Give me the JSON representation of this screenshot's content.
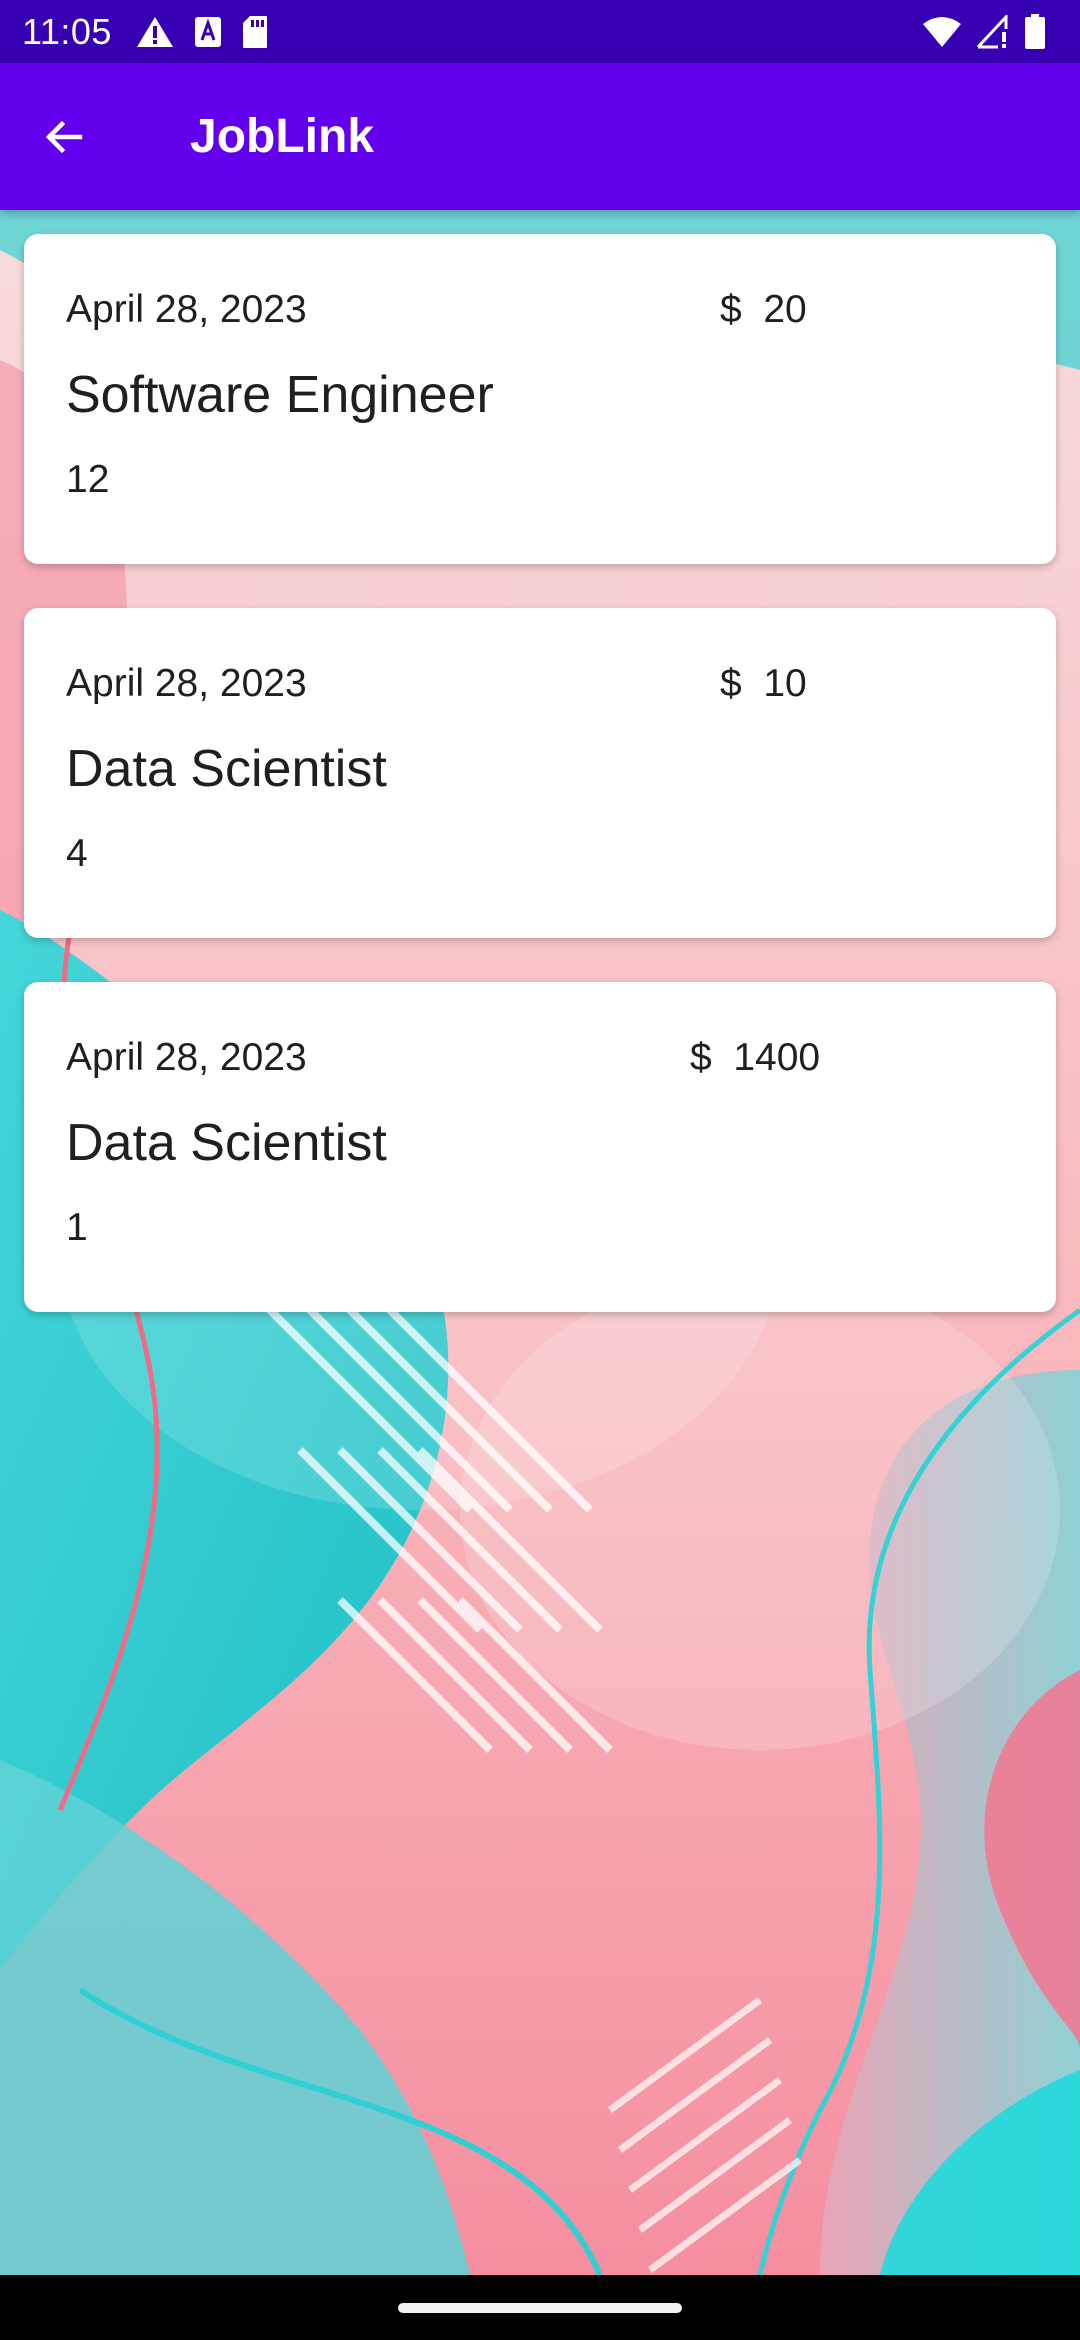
{
  "status_bar": {
    "time": "11:05",
    "icons": [
      "alert-icon",
      "text-a-icon",
      "sd-card-icon",
      "wifi-icon",
      "signal-icon",
      "battery-icon"
    ]
  },
  "app_bar": {
    "title": "JobLink",
    "back_icon": "arrow-back-icon"
  },
  "jobs": [
    {
      "date": "April 28, 2023",
      "pay": "$  20",
      "title": "Software Engineer",
      "count": "12"
    },
    {
      "date": "April 28, 2023",
      "pay": "$  10",
      "title": "Data Scientist",
      "count": "4"
    },
    {
      "date": "April 28, 2023",
      "pay": "$  1400",
      "title": "Data Scientist",
      "count": "1"
    }
  ],
  "colors": {
    "status_bar": "#3700b3",
    "app_bar": "#6200ee",
    "card": "#ffffff",
    "background_pink": "#f6c9cd",
    "background_teal": "#2cc9cf"
  }
}
